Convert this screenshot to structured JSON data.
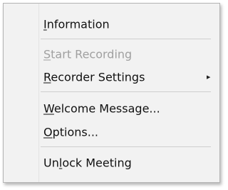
{
  "menu": {
    "items": [
      {
        "pre": "",
        "mnemonic": "I",
        "post": "nformation",
        "enabled": true
      },
      {
        "pre": "",
        "mnemonic": "S",
        "post": "tart Recording",
        "enabled": false
      },
      {
        "pre": "",
        "mnemonic": "R",
        "post": "ecorder Settings",
        "enabled": true,
        "submenu_icon": "submenu-arrow-icon"
      },
      {
        "pre": "",
        "mnemonic": "W",
        "post": "elcome Message...",
        "enabled": true
      },
      {
        "pre": "",
        "mnemonic": "O",
        "post": "ptions...",
        "enabled": true
      },
      {
        "pre": "Un",
        "mnemonic": "l",
        "post": "ock Meeting",
        "enabled": true
      }
    ]
  }
}
